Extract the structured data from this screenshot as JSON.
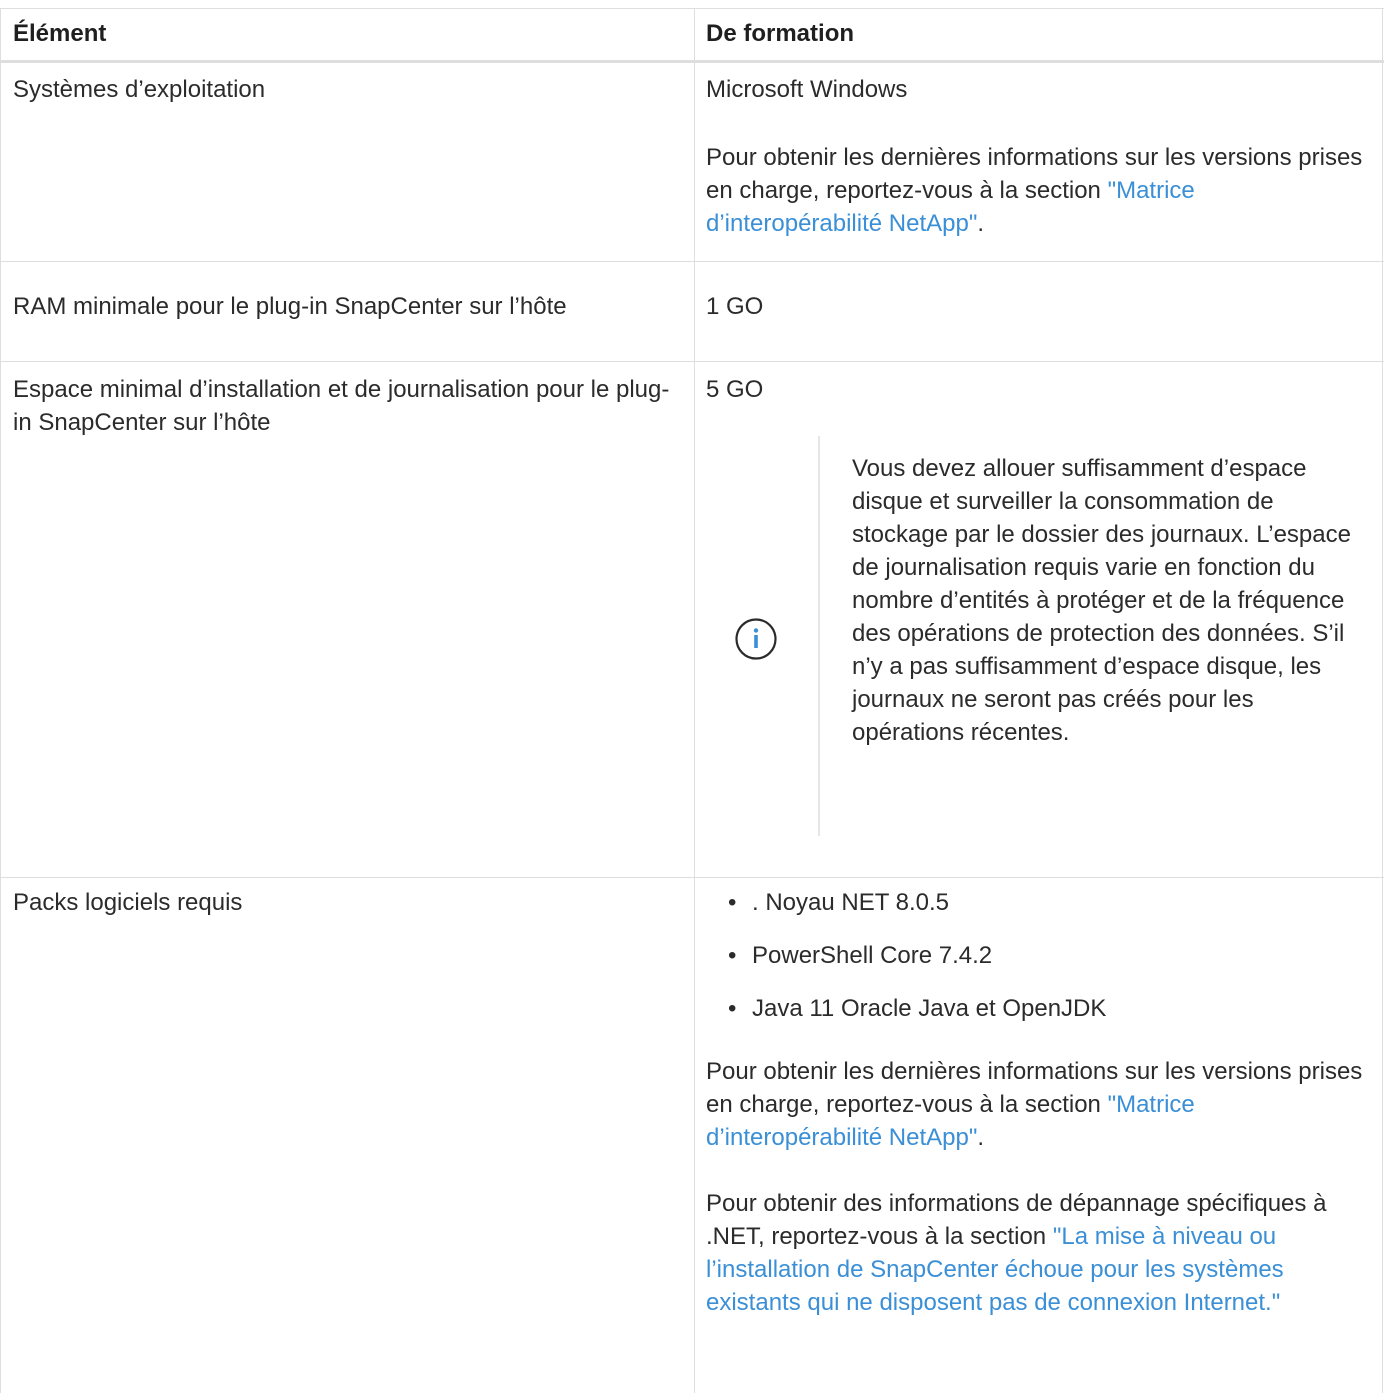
{
  "table": {
    "headers": [
      "Élément",
      "De formation"
    ],
    "rows": [
      {
        "element": "Systèmes d’exploitation",
        "value": "Microsoft Windows",
        "para_text": "Pour obtenir les dernières informations sur les versions prises en charge, reportez-vous à la section ",
        "link": "\"Matrice d’interopérabilité NetApp\"",
        "para_end": "."
      },
      {
        "element": "RAM minimale pour le plug-in SnapCenter sur l’hôte",
        "value": "1 GO"
      },
      {
        "element": "Espace minimal d’installation et de journalisation pour le plug-in SnapCenter sur l’hôte",
        "value": "5 GO",
        "note": {
          "icon": "info-circle-icon",
          "text": "Vous devez allouer suffisamment d’espace disque et surveiller la consommation de stockage par le dossier des journaux. L’espace de journalisation requis varie en fonction du nombre d’entités à protéger et de la fréquence des opérations de protection des données. S’il n’y a pas suffisamment d’espace disque, les journaux ne seront pas créés pour les opérations récentes."
        }
      },
      {
        "element": "Packs logiciels requis",
        "items": [
          ". Noyau NET 8.0.5",
          "PowerShell Core 7.4.2",
          "Java 11 Oracle Java et OpenJDK"
        ],
        "para1_text": "Pour obtenir les dernières informations sur les versions prises en charge, reportez-vous à la section ",
        "para1_link": "\"Matrice d’interopérabilité NetApp\"",
        "para1_end": ".",
        "para2_text": "Pour obtenir des informations de dépannage spécifiques à .NET, reportez-vous à la section ",
        "para2_link": "\"La mise à niveau ou l’installation de SnapCenter échoue pour les systèmes existants qui ne disposent pas de connexion Internet.\""
      }
    ]
  },
  "colors": {
    "link": "#3a8fd6",
    "rule": "#dedede",
    "text": "#2b2b2b"
  }
}
